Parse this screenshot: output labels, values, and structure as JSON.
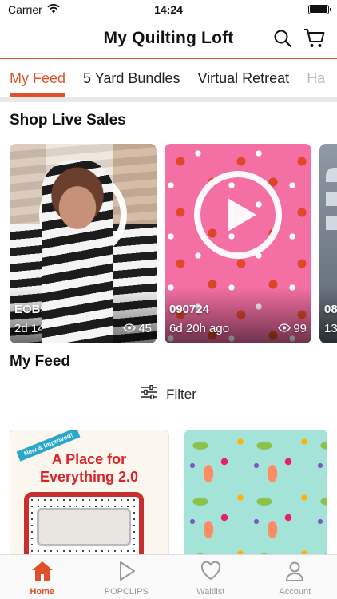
{
  "status_bar": {
    "carrier": "Carrier",
    "time": "14:24"
  },
  "header": {
    "title": "My Quilting Loft"
  },
  "tabs": [
    {
      "label": "My Feed",
      "active": true
    },
    {
      "label": "5 Yard Bundles",
      "active": false
    },
    {
      "label": "Virtual Retreat",
      "active": false
    },
    {
      "label": "Ha",
      "active": false
    }
  ],
  "live_sales": {
    "title": "Shop Live Sales",
    "items": [
      {
        "code": "EOB91124",
        "age": "2d 14h ago",
        "views": "45"
      },
      {
        "code": "090724",
        "age": "6d 20h ago",
        "views": "99"
      },
      {
        "code": "08",
        "age": "13"
      }
    ]
  },
  "feed": {
    "title": "My Feed",
    "filter_label": "Filter",
    "items": [
      {
        "badge": "New & Improved!",
        "title": "A Place for Everything 2.0"
      },
      {}
    ]
  },
  "bottom_nav": [
    {
      "label": "Home",
      "active": true
    },
    {
      "label": "POPCLIPS",
      "active": false
    },
    {
      "label": "Waitlist",
      "active": false
    },
    {
      "label": "Account",
      "active": false
    }
  ],
  "colors": {
    "accent": "#e0502a"
  }
}
